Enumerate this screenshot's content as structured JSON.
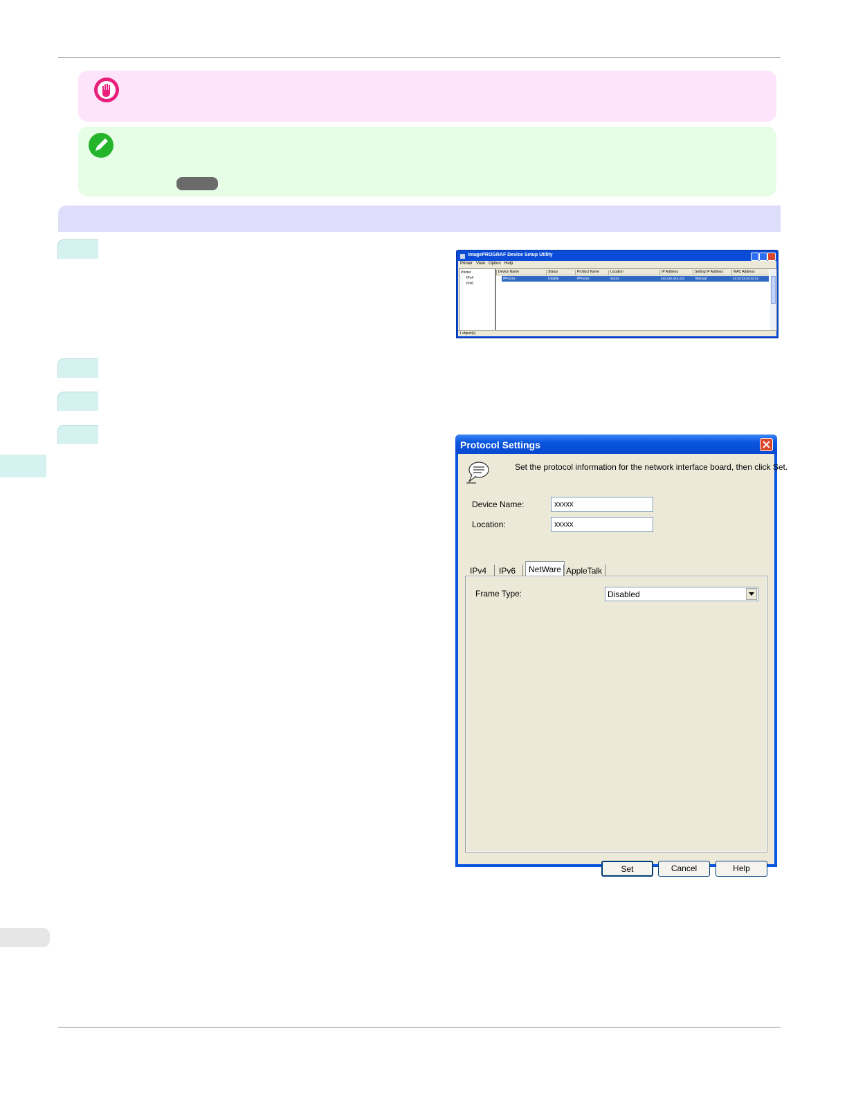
{
  "utility_window": {
    "title": "imagePROGRAF Device Setup Utility",
    "menu": [
      "Printer",
      "View",
      "Option",
      "Help"
    ],
    "tree": {
      "root": "Printer",
      "children": [
        "IPv4",
        "IPv6"
      ]
    },
    "columns": [
      "Device Name",
      "Status",
      "Product Name",
      "Location",
      "IP Address",
      "Setting IP Address",
      "MAC Address"
    ],
    "row": [
      "iPFxxxx",
      "Usable",
      "iPFxxxx",
      "xxxxx",
      "xxx.xxx.xxx.xxx",
      "Manual",
      "xx:xx:xx:xx:xx:xx"
    ],
    "status": "1 object(s)"
  },
  "dialog": {
    "title": "Protocol Settings",
    "info": "Set the protocol information for the network interface board, then click Set.",
    "device_name_label": "Device Name:",
    "device_name_value": "xxxxx",
    "location_label": "Location:",
    "location_value": "xxxxx",
    "tabs": [
      "IPv4",
      "IPv6",
      "NetWare",
      "AppleTalk"
    ],
    "active_tab": "NetWare",
    "frame_type_label": "Frame Type:",
    "frame_type_value": "Disabled",
    "buttons": {
      "set": "Set",
      "cancel": "Cancel",
      "help": "Help"
    }
  },
  "colors": {
    "important_bg": "#fde4fa",
    "tip_bg": "#e6fde6",
    "section_bg": "#dedefb",
    "step_bg": "#d6f2f0",
    "xp_blue": "#0856e0"
  }
}
